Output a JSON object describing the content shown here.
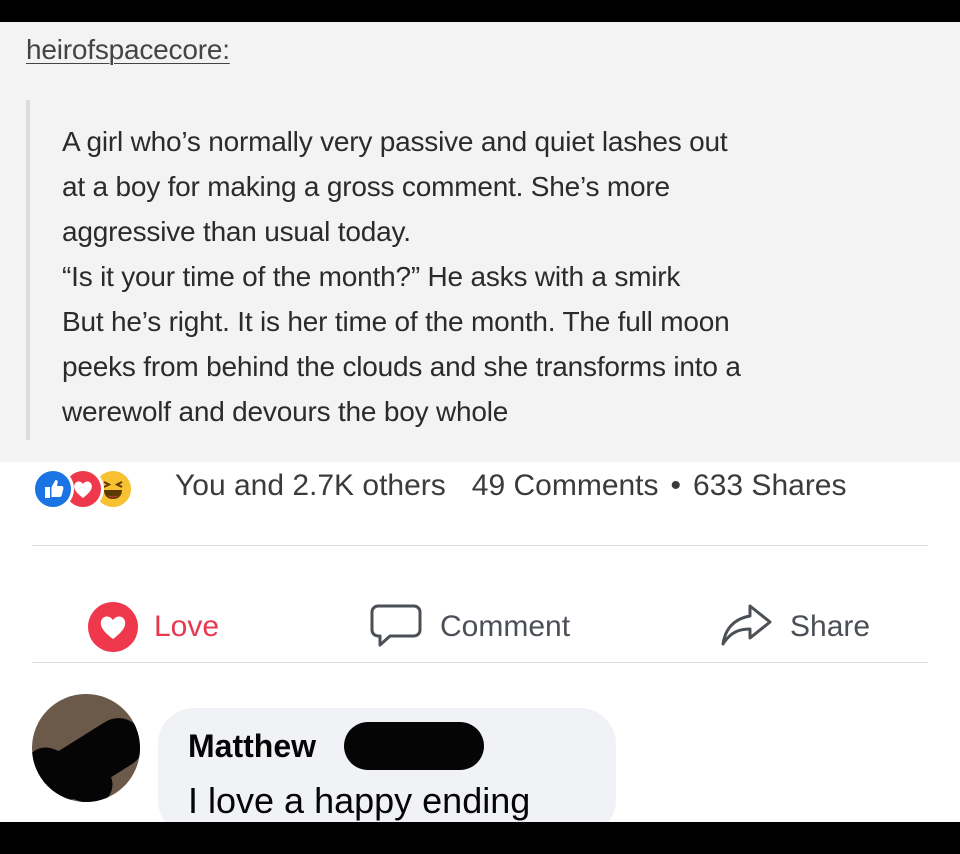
{
  "post": {
    "username": "heirofspacecore:",
    "lines": [
      "A girl who’s normally very passive and quiet lashes out",
      "at a boy for making a gross comment. She’s more",
      "aggressive than usual today.",
      "“Is it your time of the month?” He asks with a smirk",
      "But he’s right. It is her time of the month. The full moon",
      "peeks from behind the clouds and she transforms into a",
      "werewolf and devours the boy whole"
    ]
  },
  "reactions": {
    "icons": [
      "like-icon",
      "love-icon",
      "haha-icon"
    ],
    "summary": "You and 2.7K others",
    "comments": "49 Comments",
    "separator": "•",
    "shares": "633 Shares"
  },
  "actions": {
    "love_label": "Love",
    "comment_label": "Comment",
    "share_label": "Share"
  },
  "comment": {
    "author": "Matthew",
    "text": "I love a happy ending"
  },
  "colors": {
    "love": "#f0384d",
    "like": "#1b74e4",
    "haha": "#f7c131",
    "bubble": "#f0f2f5"
  }
}
